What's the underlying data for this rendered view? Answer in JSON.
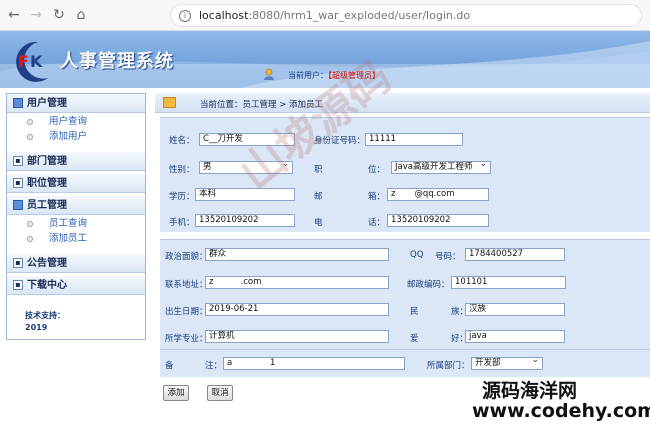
{
  "browser": {
    "url_host": "localhost",
    "url_rest": ":8080/hrm1_war_exploded/user/login.do"
  },
  "header": {
    "logo_letters": "FK",
    "app_title": "人事管理系统",
    "current_user_label": "当前用户：",
    "current_user_value": "【超级管理员】"
  },
  "sidebar": {
    "groups": [
      {
        "label": "用户管理",
        "open": true,
        "items": [
          "用户查询",
          "添加用户"
        ]
      },
      {
        "label": "部门管理",
        "open": false,
        "items": []
      },
      {
        "label": "职位管理",
        "open": false,
        "items": []
      },
      {
        "label": "员工管理",
        "open": true,
        "items": [
          "员工查询",
          "添加员工"
        ]
      },
      {
        "label": "公告管理",
        "open": false,
        "items": []
      },
      {
        "label": "下载中心",
        "open": false,
        "items": []
      }
    ],
    "tech_support_label": "技术支持：",
    "tech_support_value": "2019"
  },
  "breadcrumb": "当前位置：员工管理 > 添加员工",
  "form": {
    "name_label": "姓名：",
    "name_value": "C__刀开发",
    "idcard_label": "身份证号码：",
    "idcard_value": "11111",
    "sex_label": "性别：",
    "sex_value": "男",
    "job_label_a": "职",
    "job_label_b": "位：",
    "job_value": "Java高级开发工程师",
    "edu_label": "学历：",
    "edu_value": "本科",
    "email_label_a": "邮",
    "email_label_b": "箱：",
    "email_value_a": "z",
    "email_value_b": "@qq.com",
    "mobile_label": "手机：",
    "mobile_value": "13520109202",
    "phone_label_a": "电",
    "phone_label_b": "话：",
    "phone_value": "13520109202",
    "party_label": "政治面貌：",
    "party_value": "群众",
    "qq_label_a": "QQ",
    "qq_label_b": "号码：",
    "qq_value": "1784400527",
    "address_label": "联系地址：",
    "address_value_a": "z",
    "address_value_b": ".com",
    "postcode_label": "邮政编码：",
    "postcode_value": "101101",
    "birthday_label": "出生日期：",
    "birthday_value": "2019-06-21",
    "race_label_a": "民",
    "race_label_b": "族：",
    "race_value": "汉族",
    "major_label": "所学专业：",
    "major_value": "计算机",
    "hobby_label_a": "爱",
    "hobby_label_b": "好：",
    "hobby_value": "java",
    "remark_label_a": "备",
    "remark_label_b": "注：",
    "remark_value_a": "a",
    "remark_value_b": "1",
    "dept_label": "所属部门：",
    "dept_value": "开发部",
    "add_button": "添加",
    "cancel_button": "取消"
  },
  "watermark": {
    "diagonal": "山坡源码",
    "site_name": "源码海洋网",
    "site_url": "www.codehy.com"
  },
  "colors": {
    "banner": "#6f9edb",
    "menu_header": "#dbe7f6",
    "link": "#2a5db0",
    "label": "#1a3d7e"
  }
}
